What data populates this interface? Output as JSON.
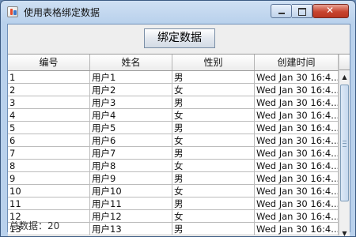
{
  "window": {
    "title": "使用表格绑定数据"
  },
  "toolbar": {
    "bind_button": "绑定数据"
  },
  "table": {
    "columns": [
      "编号",
      "姓名",
      "性别",
      "创建时间"
    ],
    "rows": [
      [
        "1",
        "用户1",
        "男",
        "Wed Jan 30 16:4..."
      ],
      [
        "2",
        "用户2",
        "女",
        "Wed Jan 30 16:4..."
      ],
      [
        "3",
        "用户3",
        "男",
        "Wed Jan 30 16:4..."
      ],
      [
        "4",
        "用户4",
        "女",
        "Wed Jan 30 16:4..."
      ],
      [
        "5",
        "用户5",
        "男",
        "Wed Jan 30 16:4..."
      ],
      [
        "6",
        "用户6",
        "女",
        "Wed Jan 30 16:4..."
      ],
      [
        "7",
        "用户7",
        "男",
        "Wed Jan 30 16:4..."
      ],
      [
        "8",
        "用户8",
        "女",
        "Wed Jan 30 16:4..."
      ],
      [
        "9",
        "用户9",
        "男",
        "Wed Jan 30 16:4..."
      ],
      [
        "10",
        "用户10",
        "女",
        "Wed Jan 30 16:4..."
      ],
      [
        "11",
        "用户11",
        "男",
        "Wed Jan 30 16:4..."
      ],
      [
        "12",
        "用户12",
        "女",
        "Wed Jan 30 16:4..."
      ],
      [
        "13",
        "用户13",
        "男",
        "Wed Jan 30 16:4..."
      ]
    ]
  },
  "status": {
    "total_label": "总数据：",
    "total_count": "20"
  },
  "icons": {
    "minimize": "minimize-icon",
    "maximize": "maximize-icon",
    "close": "close-icon",
    "scroll_up": "chevron-up-icon",
    "scroll_down": "chevron-down-icon"
  },
  "colors": {
    "titlebar": "#b9d1ec",
    "close_button": "#c8442f",
    "panel": "#eeeeee"
  }
}
